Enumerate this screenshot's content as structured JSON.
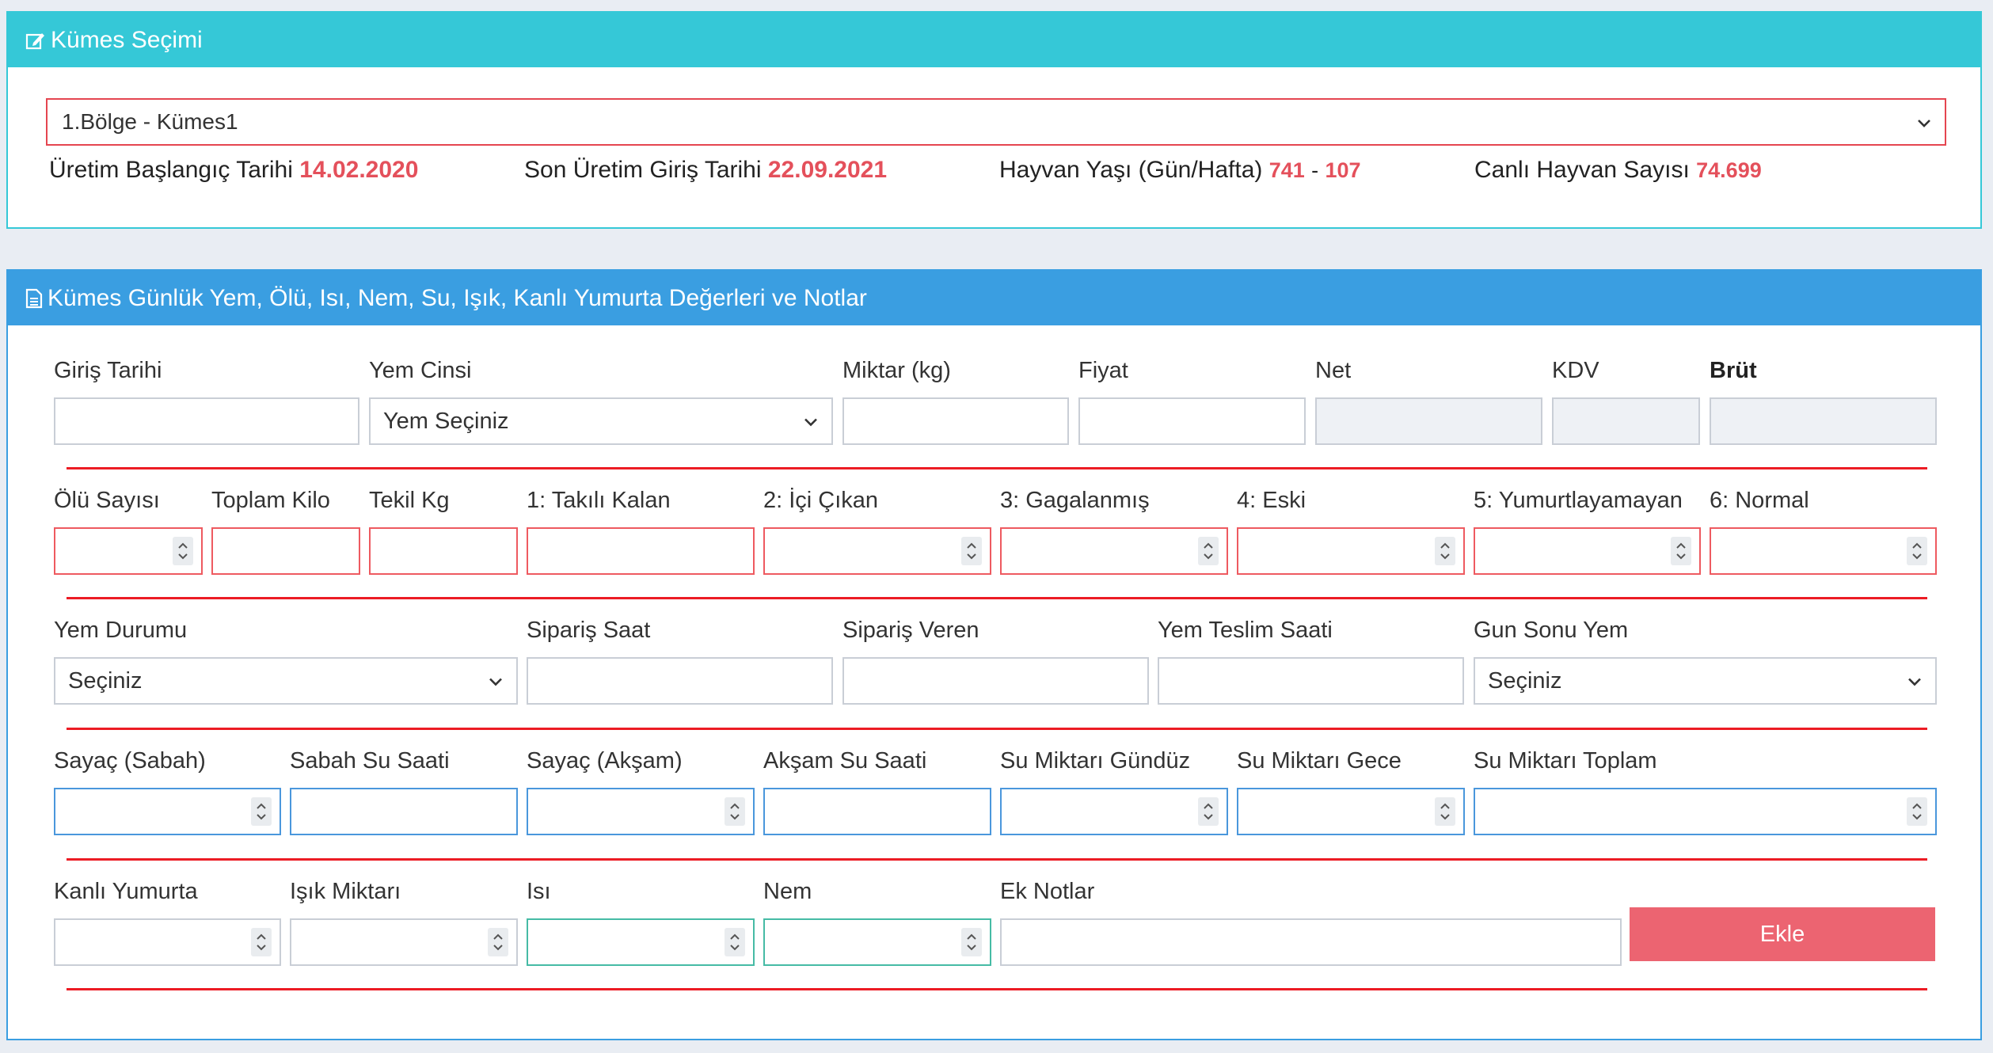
{
  "panel1": {
    "title": "Kümes Seçimi",
    "selected_coop": "1.Bölge - Kümes1",
    "production_start_label": "Üretim Başlangıç Tarihi",
    "production_start_value": "14.02.2020",
    "last_entry_label": "Son Üretim Giriş Tarihi",
    "last_entry_value": "22.09.2021",
    "animal_age_label": "Hayvan Yaşı (Gün/Hafta)",
    "animal_age_days": "741",
    "animal_age_sep": "-",
    "animal_age_weeks": "107",
    "live_count_label": "Canlı Hayvan Sayısı",
    "live_count_value": "74.699"
  },
  "panel2": {
    "title": "Kümes Günlük Yem, Ölü, Isı, Nem, Su, Işık, Kanlı Yumurta Değerleri ve Notlar",
    "row1": {
      "giris_tarihi": "Giriş Tarihi",
      "yem_cinsi": "Yem Cinsi",
      "yem_cinsi_value": "Yem Seçiniz",
      "miktar": "Miktar (kg)",
      "fiyat": "Fiyat",
      "net": "Net",
      "kdv": "KDV",
      "brut": "Brüt"
    },
    "row2": {
      "olu_sayisi": "Ölü Sayısı",
      "toplam_kilo": "Toplam Kilo",
      "tekil_kg": "Tekil Kg",
      "takili_kalan": "1: Takılı Kalan",
      "ici_cikan": "2: İçi Çıkan",
      "gagalanmis": "3: Gagalanmış",
      "eski": "4: Eski",
      "yumurtlayamayan": "5: Yumurtlayamayan",
      "normal": "6: Normal"
    },
    "row3": {
      "yem_durumu": "Yem Durumu",
      "yem_durumu_value": "Seçiniz",
      "siparis_saat": "Sipariş Saat",
      "siparis_veren": "Sipariş Veren",
      "yem_teslim_saati": "Yem Teslim Saati",
      "gun_sonu_yem": "Gun Sonu Yem",
      "gun_sonu_yem_value": "Seçiniz"
    },
    "row4": {
      "sayac_sabah": "Sayaç (Sabah)",
      "sabah_su_saati": "Sabah Su Saati",
      "sayac_aksam": "Sayaç (Akşam)",
      "aksam_su_saati": "Akşam Su Saati",
      "su_gunduz": "Su Miktarı Gündüz",
      "su_gece": "Su Miktarı Gece",
      "su_toplam": "Su Miktarı Toplam"
    },
    "row5": {
      "kanli_yumurta": "Kanlı Yumurta",
      "isik_miktari": "Işık Miktarı",
      "isi": "Isı",
      "nem": "Nem",
      "ek_notlar": "Ek Notlar",
      "ekle_button": "Ekle"
    }
  },
  "colors": {
    "panel1_header": "#35c8d7",
    "panel2_header": "#3a9ee1",
    "value_red": "#e4505b",
    "divider_red": "#ec1c24",
    "button": "#ec6471"
  },
  "icons": {
    "panel1": "edit-icon",
    "panel2": "document-icon",
    "select": "chevron-down-icon",
    "number": "spinner-icon"
  }
}
